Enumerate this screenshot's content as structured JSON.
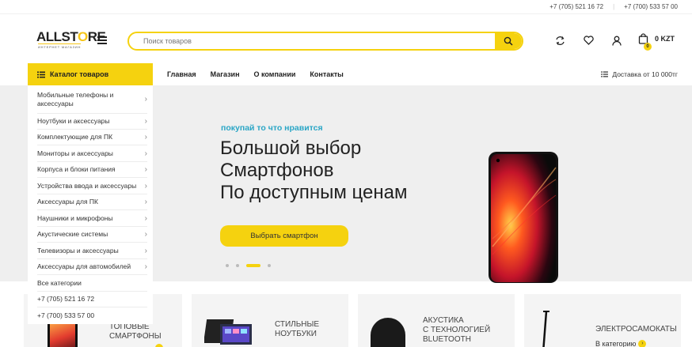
{
  "topbar": {
    "phone1": "+7 (705) 521 16 72",
    "separator": "|",
    "phone2": "+7 (700) 533 57 00"
  },
  "logo": {
    "text_a": "ALLST",
    "text_o": "O",
    "text_b": "RE",
    "subtitle": "ИНТЕРНЕТ МАГАЗИН"
  },
  "search": {
    "placeholder": "Поиск товаров"
  },
  "cart": {
    "count": "0",
    "total": "0 KZT"
  },
  "nav": {
    "catalog_label": "Каталог товаров",
    "links": [
      "Главная",
      "Магазин",
      "О компании",
      "Контакты"
    ],
    "delivery": "Доставка от 10 000тг"
  },
  "catalog": {
    "items": [
      "Мобильные телефоны и аксессуары",
      "Ноутбуки и аксессуары",
      "Комплектующие для ПК",
      "Мониторы и аксессуары",
      "Корпуса и блоки питания",
      "Устройства ввода и аксессуары",
      "Аксессуары для ПК",
      "Наушники и микрофоны",
      "Акустические системы",
      "Телевизоры и аксессуары",
      "Аксессуары для автомобилей"
    ],
    "all_label": "Все категории",
    "phone1": "+7 (705) 521 16 72",
    "phone2": "+7 (700) 533 57 00"
  },
  "hero": {
    "tagline": "покупай то что нравится",
    "title_lines": [
      "Большой выбор",
      "Смартфонов",
      "По доступным ценам"
    ],
    "button": "Выбрать смартфон",
    "slides_total": 4,
    "active_slide": 3
  },
  "cards": [
    {
      "line1": "ТОПОВЫЕ",
      "line2": "СМАРТФОНЫ"
    },
    {
      "line1": "СТИЛЬНЫЕ",
      "line2": "НОУТБУКИ"
    },
    {
      "line1": "АКУСТИКА",
      "line2": "С ТЕХНОЛОГИЕЙ",
      "line3": "BLUETOOTH"
    },
    {
      "line1": "ЭЛЕКТРОСАМОКАТЫ",
      "link": "В категорию"
    }
  ],
  "colors": {
    "accent": "#f5d20f",
    "tagline": "#2aa6c6",
    "hero_bg": "#efefef"
  }
}
